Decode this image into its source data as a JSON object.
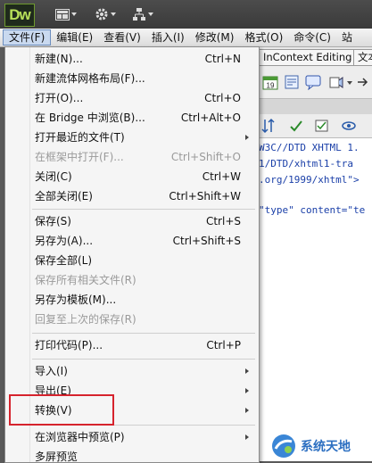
{
  "app": {
    "logo": "Dw"
  },
  "menubar": [
    "文件(F)",
    "编辑(E)",
    "查看(V)",
    "插入(I)",
    "修改(M)",
    "格式(O)",
    "命令(C)",
    "站"
  ],
  "doc_tabs": [
    "InContext Editing",
    "文本"
  ],
  "code_lines": [
    "W3C//DTD XHTML 1.",
    "1/DTD/xhtml1-tra",
    ".org/1999/xhtml\">",
    "",
    "\"type\" content=\"te"
  ],
  "file_menu": [
    {
      "label": "新建(N)...",
      "shortcut": "Ctrl+N"
    },
    {
      "label": "新建流体网格布局(F)...",
      "shortcut": ""
    },
    {
      "label": "打开(O)...",
      "shortcut": "Ctrl+O"
    },
    {
      "label": "在 Bridge 中浏览(B)...",
      "shortcut": "Ctrl+Alt+O"
    },
    {
      "label": "打开最近的文件(T)",
      "shortcut": ""
    },
    {
      "label": "在框架中打开(F)...",
      "shortcut": "Ctrl+Shift+O"
    },
    {
      "label": "关闭(C)",
      "shortcut": "Ctrl+W"
    },
    {
      "label": "全部关闭(E)",
      "shortcut": "Ctrl+Shift+W"
    },
    {
      "label": "保存(S)",
      "shortcut": "Ctrl+S"
    },
    {
      "label": "另存为(A)...",
      "shortcut": "Ctrl+Shift+S"
    },
    {
      "label": "保存全部(L)",
      "shortcut": ""
    },
    {
      "label": "保存所有相关文件(R)",
      "shortcut": ""
    },
    {
      "label": "另存为模板(M)...",
      "shortcut": ""
    },
    {
      "label": "回复至上次的保存(R)",
      "shortcut": ""
    },
    {
      "label": "打印代码(P)...",
      "shortcut": "Ctrl+P"
    },
    {
      "label": "导入(I)",
      "shortcut": ""
    },
    {
      "label": "导出(E)",
      "shortcut": ""
    },
    {
      "label": "转换(V)",
      "shortcut": ""
    },
    {
      "label": "在浏览器中预览(P)",
      "shortcut": ""
    },
    {
      "label": "多屏预览",
      "shortcut": ""
    }
  ],
  "watermark": {
    "text": "系统天地"
  },
  "colors": {
    "highlight_box": "#d6232d",
    "logo_green": "#b8e05a",
    "code_blue": "#1a3fa8"
  }
}
